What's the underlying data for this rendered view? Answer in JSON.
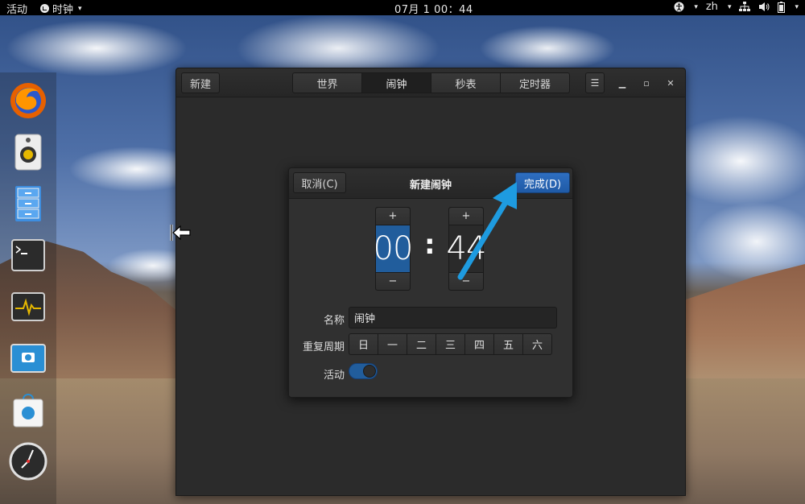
{
  "topbar": {
    "activities": "活动",
    "app_name": "时钟",
    "clock": "07月 1  00：44",
    "language": "zh",
    "icons": [
      "clock-icon",
      "accessibility-icon",
      "network-icon",
      "volume-icon",
      "battery-icon",
      "caret-down-icon"
    ]
  },
  "dock": {
    "items": [
      "firefox-icon",
      "rhythmbox-icon",
      "files-icon",
      "terminal-icon",
      "system-monitor-icon",
      "screenshot-icon",
      "software-icon",
      "clock-icon"
    ]
  },
  "window": {
    "new_button": "新建",
    "tabs": [
      {
        "label": "世界",
        "active": false
      },
      {
        "label": "闹钟",
        "active": true
      },
      {
        "label": "秒表",
        "active": false
      },
      {
        "label": "定时器",
        "active": false
      }
    ],
    "menu_icon": "hamburger-icon",
    "controls": [
      "minimize-icon",
      "maximize-icon",
      "close-icon"
    ]
  },
  "dialog": {
    "cancel": "取消(C)",
    "title": "新建闹钟",
    "done": "完成(D)",
    "hour": "00",
    "minute": "44",
    "plus": "+",
    "minus": "−",
    "colon": ":",
    "name_label": "名称",
    "name_value": "闹钟",
    "repeat_label": "重复周期",
    "days": [
      "日",
      "一",
      "二",
      "三",
      "四",
      "五",
      "六"
    ],
    "active_label": "活动",
    "active_on": true
  },
  "colors": {
    "accent": "#215d9c",
    "annotation": "#1e9be0"
  }
}
